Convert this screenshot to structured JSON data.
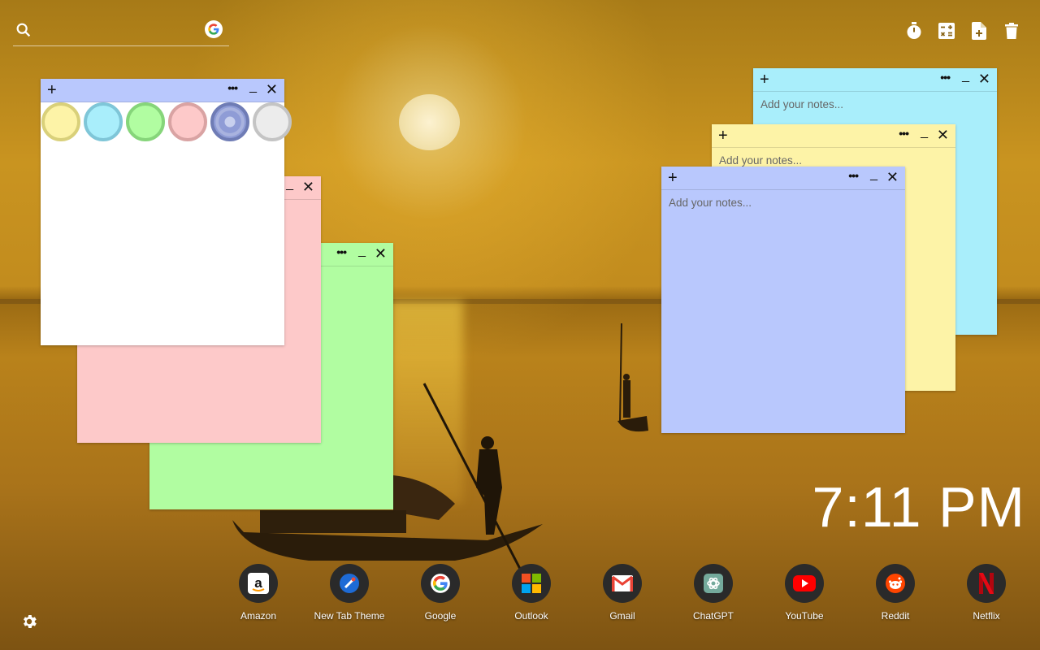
{
  "search": {
    "placeholder": "",
    "value": ""
  },
  "toolbar": {
    "icons": [
      "timer-icon",
      "calculator-icon",
      "add-note-icon",
      "trash-icon"
    ]
  },
  "notes": [
    {
      "id": "note-blue",
      "color": "#a9eefb",
      "placeholder": "Add your notes...",
      "value": ""
    },
    {
      "id": "note-yellow",
      "color": "#fdf3a7",
      "placeholder": "Add your notes...",
      "value": ""
    },
    {
      "id": "note-periwinkle",
      "color": "#b9c8fd",
      "placeholder": "Add your notes...",
      "value": ""
    },
    {
      "id": "note-green",
      "color": "#b1fda1",
      "placeholder": "",
      "value": ""
    },
    {
      "id": "note-pink",
      "color": "#fdc9c9",
      "placeholder": "",
      "value": ""
    },
    {
      "id": "note-white",
      "color": "#ffffff",
      "placeholder": "",
      "value": ""
    }
  ],
  "note_controls": {
    "plus": "+",
    "menu": "•••",
    "minimize": "_",
    "close": "✕"
  },
  "palette": [
    {
      "name": "yellow",
      "fill": "#fdf3a7",
      "ring": "#d9d07a"
    },
    {
      "name": "blue",
      "fill": "#a9eefb",
      "ring": "#7fc6d8"
    },
    {
      "name": "green",
      "fill": "#b1fda1",
      "ring": "#86d57a"
    },
    {
      "name": "pink",
      "fill": "#fdc9c9",
      "ring": "#d9a3a3"
    },
    {
      "name": "periwinkle",
      "fill": "#8f9cd6",
      "ring": "#6f7cb5",
      "selected": true
    },
    {
      "name": "gray",
      "fill": "#ececec",
      "ring": "#c4c4c4"
    }
  ],
  "clock": {
    "time": "7:11 PM"
  },
  "apps": [
    {
      "name": "Amazon",
      "icon": "amazon-icon"
    },
    {
      "name": "New Tab Theme",
      "icon": "new-tab-theme-icon"
    },
    {
      "name": "Google",
      "icon": "google-icon"
    },
    {
      "name": "Outlook",
      "icon": "microsoft-icon"
    },
    {
      "name": "Gmail",
      "icon": "gmail-icon"
    },
    {
      "name": "ChatGPT",
      "icon": "chatgpt-icon"
    },
    {
      "name": "YouTube",
      "icon": "youtube-icon"
    },
    {
      "name": "Reddit",
      "icon": "reddit-icon"
    },
    {
      "name": "Netflix",
      "icon": "netflix-icon"
    }
  ],
  "settings": {
    "icon": "gear-icon"
  }
}
